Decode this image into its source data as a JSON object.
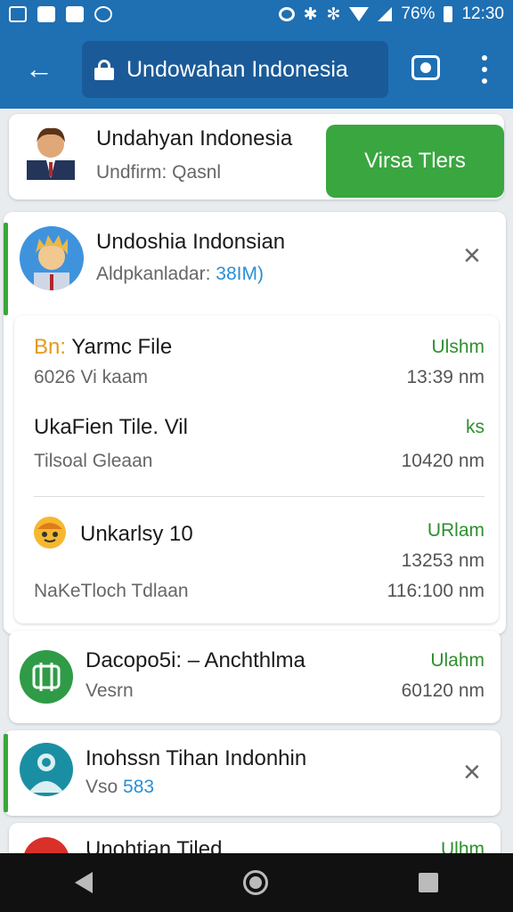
{
  "status_bar": {
    "battery": "76%",
    "time": "12:30"
  },
  "appbar": {
    "title": "Undowahan Indonesia"
  },
  "contact_card": {
    "name": "Undahyan Indonesia",
    "sub": "Undfirm: Qasnl",
    "button": "Virsa Tlers"
  },
  "profile_card": {
    "name": "Undoshia Indonsian",
    "sub_label": "Aldpkanladar:",
    "sub_link": "38IM)"
  },
  "files": {
    "r1": {
      "prefix": "Bn:",
      "name": "Yarmc File",
      "status": "Ulshm",
      "desc": "6026 Vi kaam",
      "time": "13:39 nm"
    },
    "r2": {
      "name": "UkaFien Tile. Vil",
      "status": "ks",
      "desc": "Tilsoal Gleaan",
      "time": "10420 nm"
    },
    "r3": {
      "name": "Unkarlsy 10",
      "status": "URlam",
      "time_a": "13253 nm",
      "desc": "NaKeTloch Tdlaan",
      "time_b": "116:100 nm"
    }
  },
  "card_dacop": {
    "title": "Dacopo5i: – Anchthlma",
    "status": "Ulahm",
    "sub": "Vesrn",
    "time": "60120 nm"
  },
  "card_inoh": {
    "title": "Inohssn Tihan Indonhin",
    "sub_label": "Vso",
    "sub_link": "583"
  },
  "card_partial": {
    "title": "Unohtian Tiled",
    "status": "Ulhm"
  },
  "colors": {
    "appbar": "#1f6fb3",
    "accent_green": "#3aa640",
    "link_blue": "#2b8fd6"
  }
}
